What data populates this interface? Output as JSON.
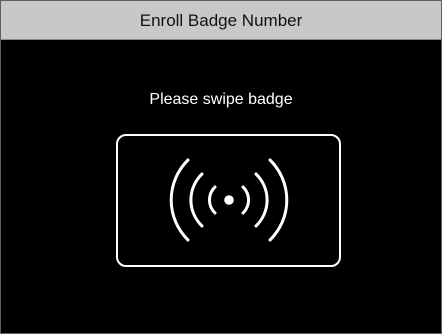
{
  "window": {
    "title": "Enroll Badge Number"
  },
  "main": {
    "prompt": "Please swipe badge",
    "reader_icon": "contactless-signal-icon"
  },
  "colors": {
    "title_bar_bg": "#c8c8c8",
    "title_text": "#111111",
    "screen_bg": "#000000",
    "foreground": "#ffffff"
  }
}
